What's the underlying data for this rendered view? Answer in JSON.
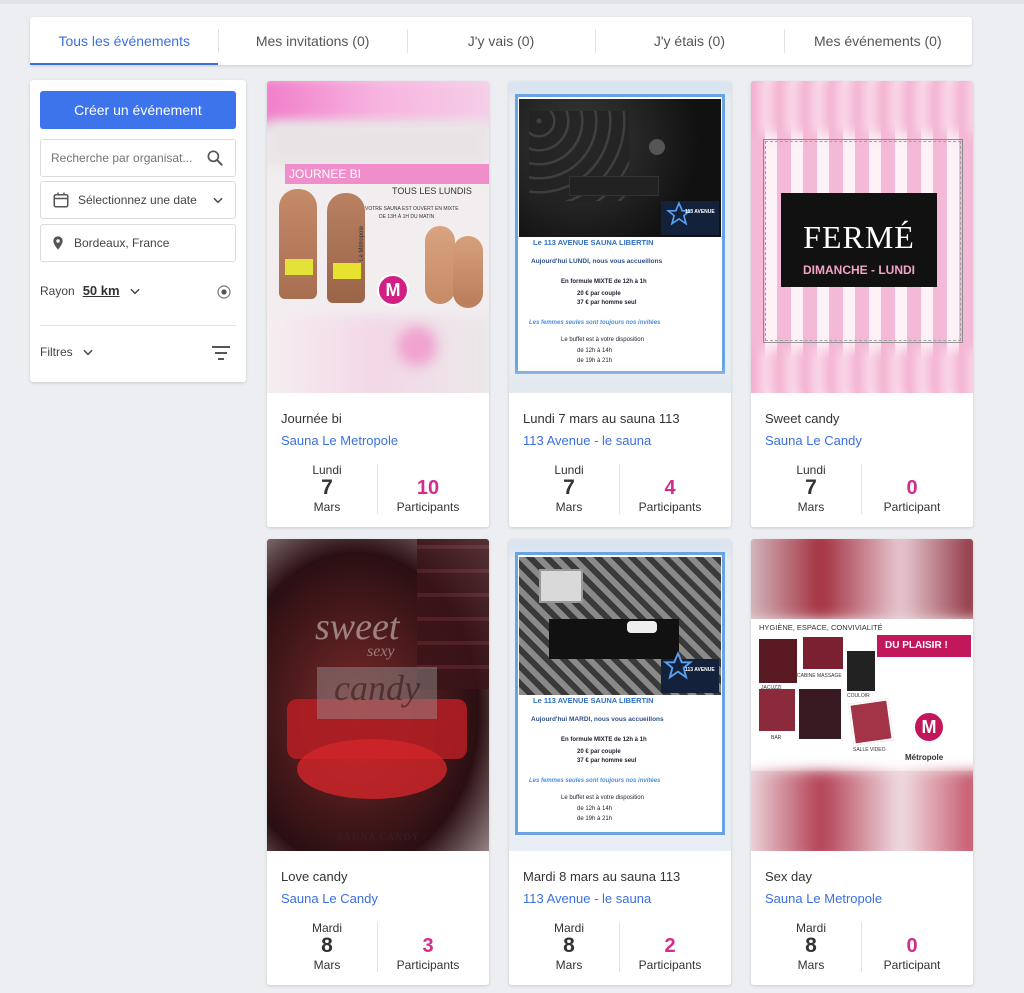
{
  "tabs": [
    {
      "label": "Tous les événements",
      "active": true
    },
    {
      "label": "Mes invitations (0)",
      "active": false
    },
    {
      "label": "J'y vais (0)",
      "active": false
    },
    {
      "label": "J'y étais (0)",
      "active": false
    },
    {
      "label": "Mes événements (0)",
      "active": false
    }
  ],
  "sidebar": {
    "create_label": "Créer un événement",
    "search_placeholder": "Recherche par organisat...",
    "date_label": "Sélectionnez une date",
    "location_value": "Bordeaux, France",
    "rayon_label": "Rayon",
    "rayon_value": "50 km",
    "filters_label": "Filtres"
  },
  "colors": {
    "accent": "#3d74eb",
    "link": "#3b6fe0",
    "count": "#d22c8c"
  },
  "events": [
    {
      "title": "Journée bi",
      "venue": "Sauna Le Metropole",
      "dow": "Lundi",
      "day": "7",
      "month": "Mars",
      "count": "10",
      "count_label": "Participants",
      "poster": {
        "headline": "JOURNEE BI",
        "sub": "TOUS LES LUNDIS",
        "line1": "VOTRE SAUNA EST OUVERT EN MIXTE",
        "line2": "DE 13H À 1H DU MATIN",
        "logo_letter": "M",
        "logo_label": "Le Métropole"
      }
    },
    {
      "title": "Lundi 7 mars au sauna 113",
      "venue": "113 Avenue - le sauna",
      "dow": "Lundi",
      "day": "7",
      "month": "Mars",
      "count": "4",
      "count_label": "Participants",
      "poster": {
        "header": "Le 113 AVENUE SAUNA LIBERTIN",
        "welcome": "Aujourd'hui LUNDI, nous vous accueillons",
        "f1": "En formule MIXTE de 12h à 1h",
        "f2": "20 € par couple",
        "f3": "37 € par homme seul",
        "women": "Les femmes seules sont toujours nos invitées",
        "buffet": "Le buffet est à votre disposition",
        "b1": "de 12h à 14h",
        "b2": "de 19h à 21h",
        "logo": "113 AVENUE"
      }
    },
    {
      "title": "Sweet candy",
      "venue": "Sauna Le Candy",
      "dow": "Lundi",
      "day": "7",
      "month": "Mars",
      "count": "0",
      "count_label": "Participant",
      "poster": {
        "big": "FERMÉ",
        "small": "DIMANCHE - LUNDI"
      }
    },
    {
      "title": "Love candy",
      "venue": "Sauna Le Candy",
      "dow": "Mardi",
      "day": "8",
      "month": "Mars",
      "count": "3",
      "count_label": "Participants",
      "poster": {
        "w1": "sweet",
        "w2": "sexy",
        "w3": "candy",
        "footer": "SAUNA CANDY"
      }
    },
    {
      "title": "Mardi 8 mars au sauna 113",
      "venue": "113 Avenue - le sauna",
      "dow": "Mardi",
      "day": "8",
      "month": "Mars",
      "count": "2",
      "count_label": "Participants",
      "poster": {
        "header": "Le 113 AVENUE SAUNA LIBERTIN",
        "welcome": "Aujourd'hui MARDI, nous vous accueillons",
        "f1": "En formule MIXTE de 12h à 1h",
        "f2": "20 € par couple",
        "f3": "37 € par homme seul",
        "women": "Les femmes seules sont toujours nos invitées",
        "buffet": "Le buffet est à votre disposition",
        "b1": "de 12h à 14h",
        "b2": "de 19h à 21h",
        "logo": "113 AVENUE"
      }
    },
    {
      "title": "Sex day",
      "venue": "Sauna Le Metropole",
      "dow": "Mardi",
      "day": "8",
      "month": "Mars",
      "count": "0",
      "count_label": "Participant",
      "poster": {
        "top": "HYGIÈNE, ESPACE, CONVIVIALITÉ",
        "plaisir": "DU PLAISIR !",
        "l1": "JACUZZI",
        "l2": "CABINE MASSAGE",
        "l3": "COULOIR",
        "l4": "BAR",
        "l5": "SALLE VIDEO",
        "logo_letter": "M",
        "logo_label": "Métropole"
      }
    }
  ]
}
